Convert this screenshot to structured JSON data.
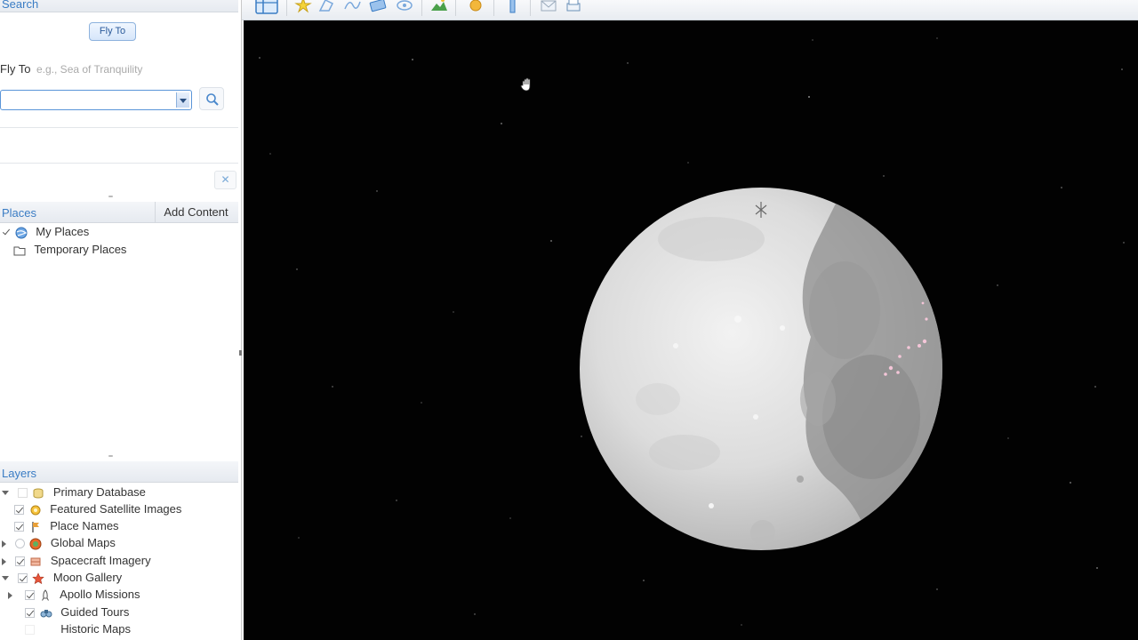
{
  "search": {
    "title": "Search",
    "fly_to_tab": "Fly To",
    "fly_to_label": "Fly To",
    "fly_to_hint": "e.g., Sea of Tranquility",
    "input_value": ""
  },
  "places": {
    "title": "Places",
    "add_content": "Add Content",
    "items": [
      {
        "label": "My Places",
        "icon": "globe-icon",
        "checked": true
      },
      {
        "label": "Temporary Places",
        "icon": "folder-icon",
        "checked": false
      }
    ]
  },
  "layers": {
    "title": "Layers",
    "items": [
      {
        "label": "Primary Database",
        "icon": "database-icon"
      },
      {
        "label": "Featured Satellite Images",
        "icon": "satellite-icon",
        "checked": true
      },
      {
        "label": "Place Names",
        "icon": "flag-icon",
        "checked": true
      },
      {
        "label": "Global Maps",
        "icon": "globe-map-icon",
        "checked": false
      },
      {
        "label": "Spacecraft Imagery",
        "icon": "spacecraft-icon",
        "checked": true
      },
      {
        "label": "Moon Gallery",
        "icon": "star-icon",
        "checked": true
      },
      {
        "label": "Apollo Missions",
        "icon": "rocket-icon",
        "checked": true
      },
      {
        "label": "Guided Tours",
        "icon": "binoculars-icon",
        "checked": true
      },
      {
        "label": "Historic Maps",
        "icon": "map-icon",
        "checked": false
      }
    ]
  },
  "toolbar": {
    "buttons": [
      "sidebar-toggle-icon",
      "placemark-icon",
      "polygon-icon",
      "path-icon",
      "image-overlay-icon",
      "record-tour-icon",
      "terrain-icon",
      "sun-icon",
      "ruler-icon",
      "email-icon",
      "print-icon"
    ]
  },
  "colors": {
    "accent": "#3a7cc4",
    "space": "#020202"
  }
}
